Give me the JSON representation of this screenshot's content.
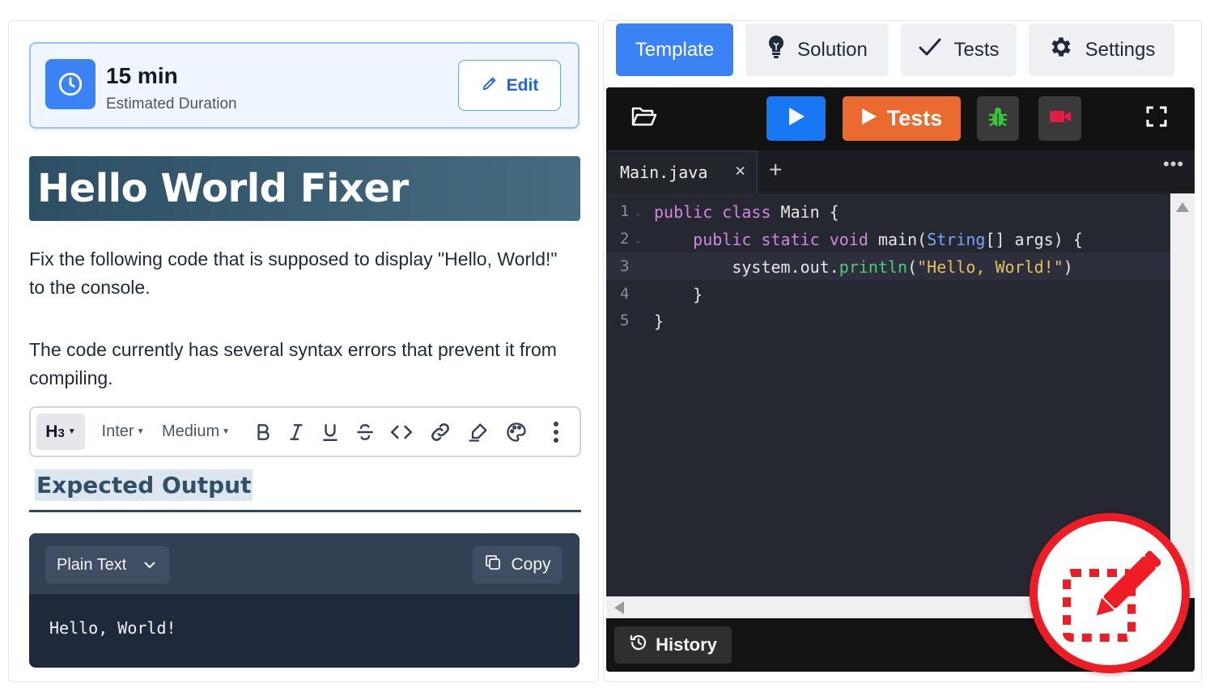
{
  "duration": {
    "value": "15 min",
    "label": "Estimated Duration",
    "edit_label": "Edit"
  },
  "title": "Hello World Fixer",
  "description": {
    "paragraph_1": "Fix the following code that is supposed to display \"Hello, World!\" to the console.",
    "paragraph_2": "The code currently has several syntax errors that prevent it from compiling."
  },
  "toolbar": {
    "heading_level": "H",
    "heading_sub": "3",
    "font": "Inter",
    "weight": "Medium"
  },
  "expected_output": {
    "heading": "Expected Output",
    "language": "Plain Text",
    "copy_label": "Copy",
    "code": "Hello, World!"
  },
  "tabs": {
    "template": "Template",
    "solution": "Solution",
    "tests": "Tests",
    "settings": "Settings"
  },
  "ide": {
    "run_tests_label": "Tests",
    "file_name": "Main.java",
    "close_symbol": "×",
    "add_symbol": "+",
    "more_symbol": "•••",
    "history_label": "History",
    "lines": [
      {
        "n": "1"
      },
      {
        "n": "2"
      },
      {
        "n": "3"
      },
      {
        "n": "4"
      },
      {
        "n": "5"
      }
    ]
  },
  "colors": {
    "accent": "#3b82f6",
    "tests_button": "#ea6b2f",
    "fab_border": "#ee1c24"
  }
}
